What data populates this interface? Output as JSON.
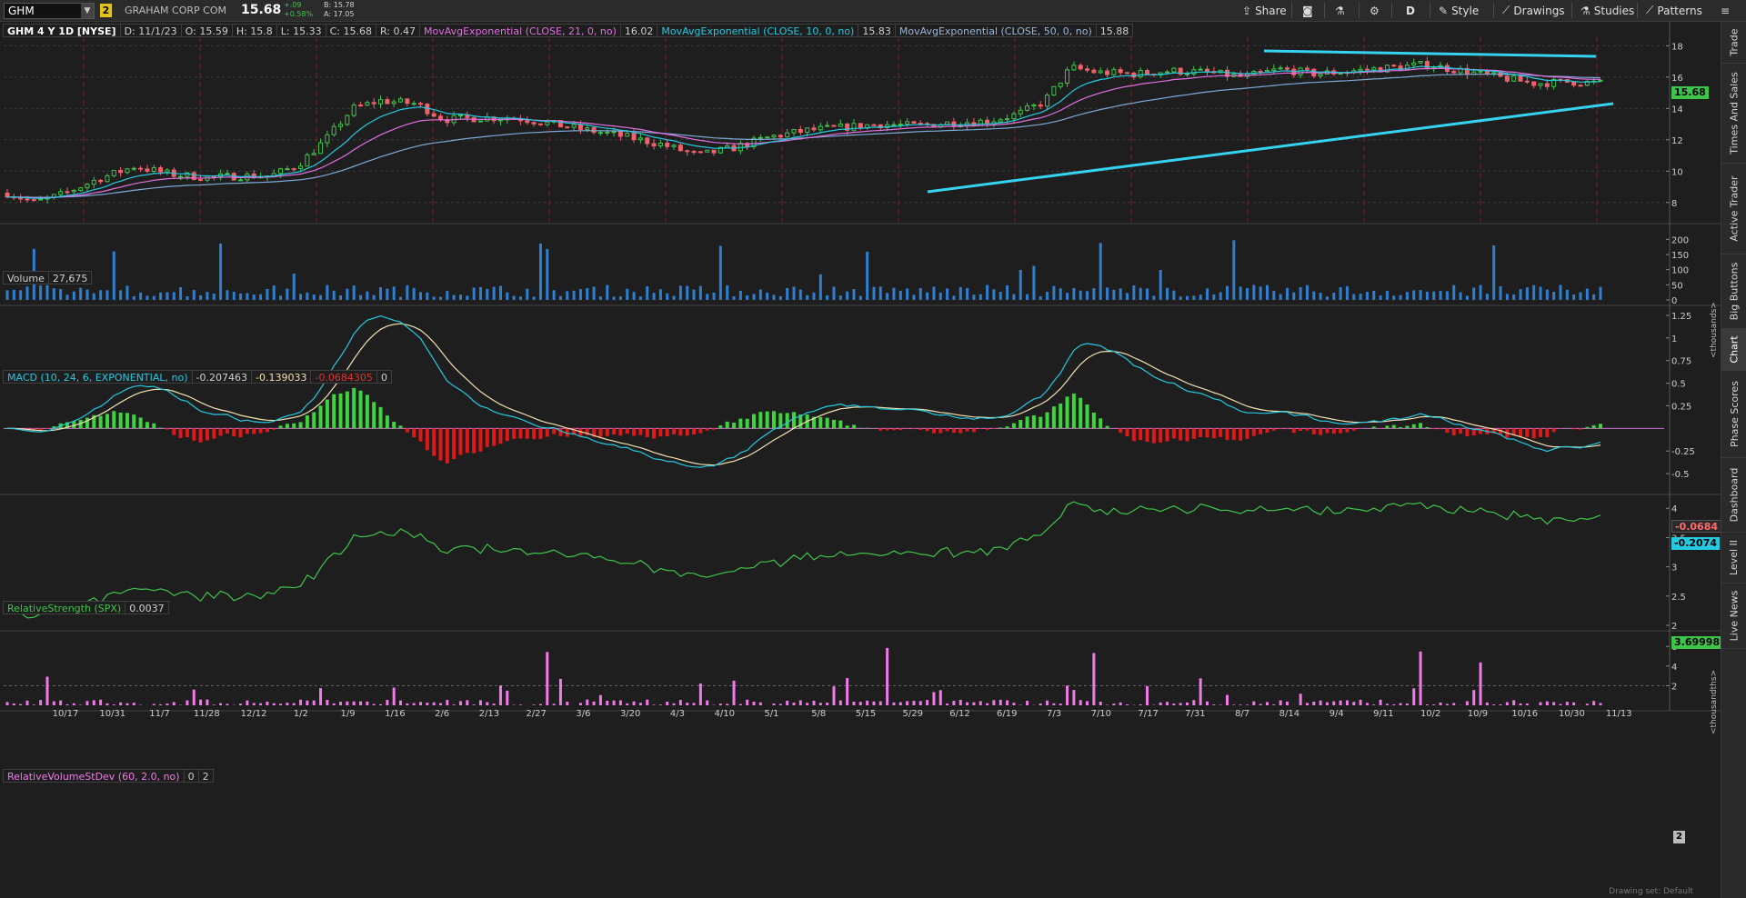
{
  "toolbar": {
    "symbol": "GHM",
    "link_badge": "2",
    "company_name": "GRAHAM CORP COM",
    "last_price": "15.68",
    "change_abs": "+.09",
    "change_pct": "+0.58%",
    "bid": "B: 15.78",
    "ask": "A: 17.05",
    "buttons": {
      "share": "Share",
      "timeframe": "D",
      "style": "Style",
      "drawings": "Drawings",
      "studies": "Studies",
      "patterns": "Patterns"
    }
  },
  "price_header": {
    "title": "GHM 4 Y 1D [NYSE]",
    "date": "D: 11/1/23",
    "open": "O: 15.59",
    "high": "H: 15.8",
    "low": "L: 15.33",
    "close": "C: 15.68",
    "range": "R: 0.47",
    "ema21_label": "MovAvgExponential (CLOSE, 21, 0, no)",
    "ema21_value": "16.02",
    "ema10_label": "MovAvgExponential (CLOSE, 10, 0, no)",
    "ema10_value": "15.83",
    "ema50_label": "MovAvgExponential (CLOSE, 50, 0, no)",
    "ema50_value": "15.88"
  },
  "volume_header": {
    "label": "Volume",
    "value": "27,675"
  },
  "macd_header": {
    "label": "MACD (10, 24, 6, EXPONENTIAL, no)",
    "value": "-0.207463",
    "avg": "-0.139033",
    "diff": "-0.0684305",
    "zero": "0"
  },
  "rs_header": {
    "label": "RelativeStrength (SPX)",
    "value": "0.0037"
  },
  "rvsd_header": {
    "label": "RelativeVolumeStDev (60, 2.0, no)",
    "v1": "0",
    "v2": "2"
  },
  "axes": {
    "price_ticks": [
      "18",
      "16",
      "14",
      "12",
      "10",
      "8"
    ],
    "volume_ticks": [
      "200",
      "150",
      "100",
      "50",
      "0"
    ],
    "volume_unit": "<thousands>",
    "macd_ticks": [
      "1.25",
      "1",
      "0.75",
      "0.5",
      "0.25",
      "-0.25",
      "-0.5"
    ],
    "rs_ticks": [
      "4",
      "3.5",
      "3",
      "2.5",
      "2"
    ],
    "rs_unit": "<thousandths>",
    "rvsd_ticks": [
      "6",
      "4",
      "2"
    ],
    "rvsd_tag": "2",
    "x_ticks": [
      "10/17",
      "10/31",
      "11/7",
      "11/28",
      "12/12",
      "1/2",
      "1/9",
      "1/16",
      "2/6",
      "2/13",
      "2/27",
      "3/6",
      "3/20",
      "4/3",
      "4/10",
      "5/1",
      "5/8",
      "5/15",
      "5/29",
      "6/12",
      "6/19",
      "7/3",
      "7/10",
      "7/17",
      "7/31",
      "8/7",
      "8/14",
      "9/4",
      "9/11",
      "10/2",
      "10/9",
      "10/16",
      "10/30",
      "11/13"
    ]
  },
  "price_tags": {
    "price": "15.68",
    "macd_diff": "-0.0684",
    "macd_value": "-0.2074",
    "rs": "3.69998"
  },
  "side_tabs": [
    "Trade",
    "Times And Sales",
    "Active Trader",
    "Big Buttons",
    "Chart",
    "Phase Scores",
    "Dashboard",
    "Level II",
    "Live News"
  ],
  "status": {
    "drawing_set": "Drawing set: Default"
  },
  "colors": {
    "up": "#3fc44a",
    "down": "#f0616b",
    "ema10": "#25c9e0",
    "ema21": "#e070e0",
    "ema50": "#7fa8d8",
    "trendline": "#35d3f0",
    "volume": "#2f7fd0",
    "macd": "#25c9e0",
    "macd_avg": "#f3e0b0",
    "rs": "#3fc44a",
    "rvsd": "#f07ae8"
  }
}
